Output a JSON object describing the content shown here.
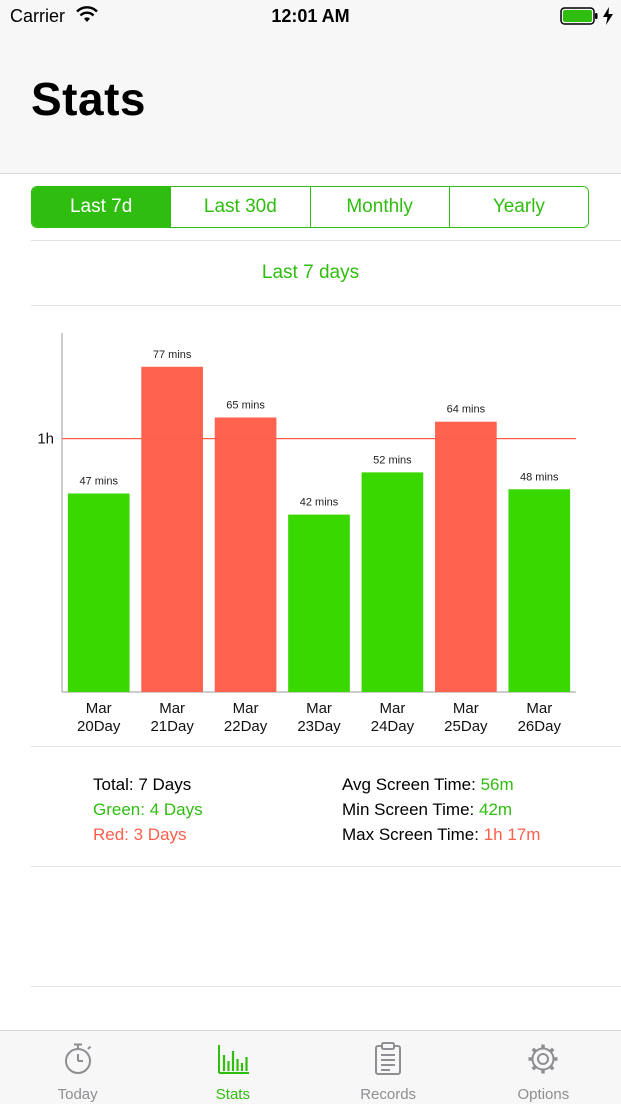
{
  "status_bar": {
    "carrier": "Carrier",
    "time": "12:01 AM"
  },
  "header": {
    "title": "Stats"
  },
  "segments": [
    {
      "label": "Last 7d",
      "active": true
    },
    {
      "label": "Last 30d",
      "active": false
    },
    {
      "label": "Monthly",
      "active": false
    },
    {
      "label": "Yearly",
      "active": false
    }
  ],
  "range_label": "Last 7 days",
  "chart_data": {
    "type": "bar",
    "categories": [
      "Mar 20Day",
      "Mar 21Day",
      "Mar 22Day",
      "Mar 23Day",
      "Mar 24Day",
      "Mar 25Day",
      "Mar 26Day"
    ],
    "category_lines": [
      [
        "Mar",
        "20Day"
      ],
      [
        "Mar",
        "21Day"
      ],
      [
        "Mar",
        "22Day"
      ],
      [
        "Mar",
        "23Day"
      ],
      [
        "Mar",
        "24Day"
      ],
      [
        "Mar",
        "25Day"
      ],
      [
        "Mar",
        "26Day"
      ]
    ],
    "values": [
      47,
      77,
      65,
      42,
      52,
      64,
      48
    ],
    "value_labels": [
      "47 mins",
      "77 mins",
      "65 mins",
      "42 mins",
      "52 mins",
      "64 mins",
      "48 mins"
    ],
    "unit": "mins",
    "threshold": {
      "value": 60,
      "label": "1h",
      "color": "#ff5e4b"
    },
    "ylim": [
      0,
      85
    ],
    "colors": {
      "below": "#38d800",
      "above": "#ff634f"
    },
    "grid": false
  },
  "summary": {
    "total": "Total: 7 Days",
    "green": "Green: 4 Days",
    "red": "Red: 3 Days",
    "avg_label": "Avg Screen Time: ",
    "avg_value": "56m",
    "min_label": "Min Screen Time: ",
    "min_value": "42m",
    "max_label": "Max Screen Time: ",
    "max_value": "1h 17m"
  },
  "tabs": [
    {
      "label": "Today",
      "icon": "stopwatch-icon",
      "active": false
    },
    {
      "label": "Stats",
      "icon": "bar-chart-icon",
      "active": true
    },
    {
      "label": "Records",
      "icon": "clipboard-icon",
      "active": false
    },
    {
      "label": "Options",
      "icon": "gear-icon",
      "active": false
    }
  ],
  "colors": {
    "accent": "#2fbd10",
    "alert": "#ff5e4b"
  }
}
